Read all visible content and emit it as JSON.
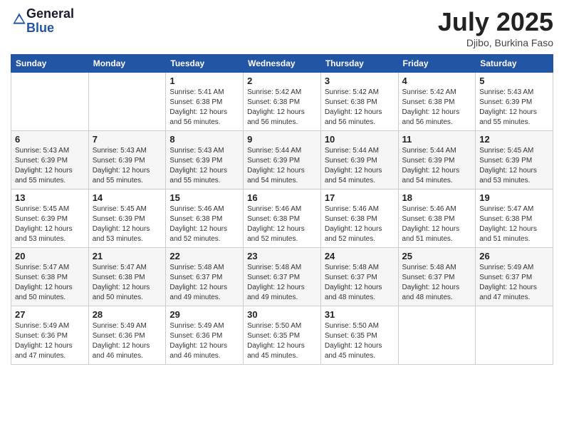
{
  "logo": {
    "general": "General",
    "blue": "Blue"
  },
  "title": "July 2025",
  "location": "Djibo, Burkina Faso",
  "days_of_week": [
    "Sunday",
    "Monday",
    "Tuesday",
    "Wednesday",
    "Thursday",
    "Friday",
    "Saturday"
  ],
  "weeks": [
    [
      {
        "day": "",
        "sunrise": "",
        "sunset": "",
        "daylight": ""
      },
      {
        "day": "",
        "sunrise": "",
        "sunset": "",
        "daylight": ""
      },
      {
        "day": "1",
        "sunrise": "Sunrise: 5:41 AM",
        "sunset": "Sunset: 6:38 PM",
        "daylight": "Daylight: 12 hours and 56 minutes."
      },
      {
        "day": "2",
        "sunrise": "Sunrise: 5:42 AM",
        "sunset": "Sunset: 6:38 PM",
        "daylight": "Daylight: 12 hours and 56 minutes."
      },
      {
        "day": "3",
        "sunrise": "Sunrise: 5:42 AM",
        "sunset": "Sunset: 6:38 PM",
        "daylight": "Daylight: 12 hours and 56 minutes."
      },
      {
        "day": "4",
        "sunrise": "Sunrise: 5:42 AM",
        "sunset": "Sunset: 6:38 PM",
        "daylight": "Daylight: 12 hours and 56 minutes."
      },
      {
        "day": "5",
        "sunrise": "Sunrise: 5:43 AM",
        "sunset": "Sunset: 6:39 PM",
        "daylight": "Daylight: 12 hours and 55 minutes."
      }
    ],
    [
      {
        "day": "6",
        "sunrise": "Sunrise: 5:43 AM",
        "sunset": "Sunset: 6:39 PM",
        "daylight": "Daylight: 12 hours and 55 minutes."
      },
      {
        "day": "7",
        "sunrise": "Sunrise: 5:43 AM",
        "sunset": "Sunset: 6:39 PM",
        "daylight": "Daylight: 12 hours and 55 minutes."
      },
      {
        "day": "8",
        "sunrise": "Sunrise: 5:43 AM",
        "sunset": "Sunset: 6:39 PM",
        "daylight": "Daylight: 12 hours and 55 minutes."
      },
      {
        "day": "9",
        "sunrise": "Sunrise: 5:44 AM",
        "sunset": "Sunset: 6:39 PM",
        "daylight": "Daylight: 12 hours and 54 minutes."
      },
      {
        "day": "10",
        "sunrise": "Sunrise: 5:44 AM",
        "sunset": "Sunset: 6:39 PM",
        "daylight": "Daylight: 12 hours and 54 minutes."
      },
      {
        "day": "11",
        "sunrise": "Sunrise: 5:44 AM",
        "sunset": "Sunset: 6:39 PM",
        "daylight": "Daylight: 12 hours and 54 minutes."
      },
      {
        "day": "12",
        "sunrise": "Sunrise: 5:45 AM",
        "sunset": "Sunset: 6:39 PM",
        "daylight": "Daylight: 12 hours and 53 minutes."
      }
    ],
    [
      {
        "day": "13",
        "sunrise": "Sunrise: 5:45 AM",
        "sunset": "Sunset: 6:39 PM",
        "daylight": "Daylight: 12 hours and 53 minutes."
      },
      {
        "day": "14",
        "sunrise": "Sunrise: 5:45 AM",
        "sunset": "Sunset: 6:39 PM",
        "daylight": "Daylight: 12 hours and 53 minutes."
      },
      {
        "day": "15",
        "sunrise": "Sunrise: 5:46 AM",
        "sunset": "Sunset: 6:38 PM",
        "daylight": "Daylight: 12 hours and 52 minutes."
      },
      {
        "day": "16",
        "sunrise": "Sunrise: 5:46 AM",
        "sunset": "Sunset: 6:38 PM",
        "daylight": "Daylight: 12 hours and 52 minutes."
      },
      {
        "day": "17",
        "sunrise": "Sunrise: 5:46 AM",
        "sunset": "Sunset: 6:38 PM",
        "daylight": "Daylight: 12 hours and 52 minutes."
      },
      {
        "day": "18",
        "sunrise": "Sunrise: 5:46 AM",
        "sunset": "Sunset: 6:38 PM",
        "daylight": "Daylight: 12 hours and 51 minutes."
      },
      {
        "day": "19",
        "sunrise": "Sunrise: 5:47 AM",
        "sunset": "Sunset: 6:38 PM",
        "daylight": "Daylight: 12 hours and 51 minutes."
      }
    ],
    [
      {
        "day": "20",
        "sunrise": "Sunrise: 5:47 AM",
        "sunset": "Sunset: 6:38 PM",
        "daylight": "Daylight: 12 hours and 50 minutes."
      },
      {
        "day": "21",
        "sunrise": "Sunrise: 5:47 AM",
        "sunset": "Sunset: 6:38 PM",
        "daylight": "Daylight: 12 hours and 50 minutes."
      },
      {
        "day": "22",
        "sunrise": "Sunrise: 5:48 AM",
        "sunset": "Sunset: 6:37 PM",
        "daylight": "Daylight: 12 hours and 49 minutes."
      },
      {
        "day": "23",
        "sunrise": "Sunrise: 5:48 AM",
        "sunset": "Sunset: 6:37 PM",
        "daylight": "Daylight: 12 hours and 49 minutes."
      },
      {
        "day": "24",
        "sunrise": "Sunrise: 5:48 AM",
        "sunset": "Sunset: 6:37 PM",
        "daylight": "Daylight: 12 hours and 48 minutes."
      },
      {
        "day": "25",
        "sunrise": "Sunrise: 5:48 AM",
        "sunset": "Sunset: 6:37 PM",
        "daylight": "Daylight: 12 hours and 48 minutes."
      },
      {
        "day": "26",
        "sunrise": "Sunrise: 5:49 AM",
        "sunset": "Sunset: 6:37 PM",
        "daylight": "Daylight: 12 hours and 47 minutes."
      }
    ],
    [
      {
        "day": "27",
        "sunrise": "Sunrise: 5:49 AM",
        "sunset": "Sunset: 6:36 PM",
        "daylight": "Daylight: 12 hours and 47 minutes."
      },
      {
        "day": "28",
        "sunrise": "Sunrise: 5:49 AM",
        "sunset": "Sunset: 6:36 PM",
        "daylight": "Daylight: 12 hours and 46 minutes."
      },
      {
        "day": "29",
        "sunrise": "Sunrise: 5:49 AM",
        "sunset": "Sunset: 6:36 PM",
        "daylight": "Daylight: 12 hours and 46 minutes."
      },
      {
        "day": "30",
        "sunrise": "Sunrise: 5:50 AM",
        "sunset": "Sunset: 6:35 PM",
        "daylight": "Daylight: 12 hours and 45 minutes."
      },
      {
        "day": "31",
        "sunrise": "Sunrise: 5:50 AM",
        "sunset": "Sunset: 6:35 PM",
        "daylight": "Daylight: 12 hours and 45 minutes."
      },
      {
        "day": "",
        "sunrise": "",
        "sunset": "",
        "daylight": ""
      },
      {
        "day": "",
        "sunrise": "",
        "sunset": "",
        "daylight": ""
      }
    ]
  ]
}
